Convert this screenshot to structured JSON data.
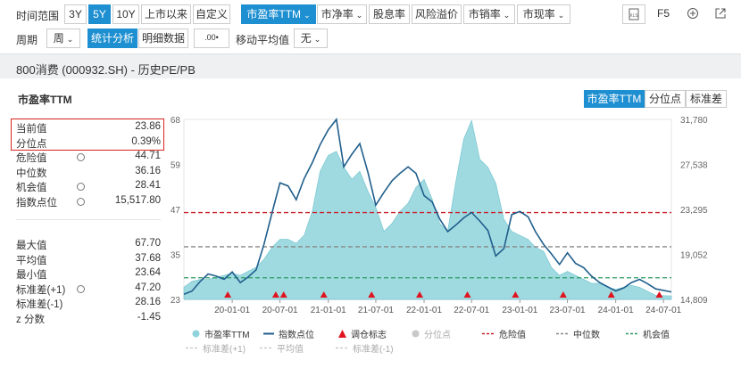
{
  "toolbar1": {
    "range_label": "时间范围",
    "range_buttons": [
      "3Y",
      "5Y",
      "10Y",
      "上市以来",
      "自定义"
    ],
    "metric_buttons": [
      "市盈率TTM",
      "市净率",
      "股息率",
      "风险溢价",
      "市销率",
      "市现率"
    ],
    "right_icons": [
      "excel-icon",
      "refresh-icon",
      "zoom-in-icon",
      "share-icon"
    ],
    "refresh_label": "F5"
  },
  "toolbar2": {
    "period_label": "周期",
    "period_value": "周",
    "analysis_tabs": [
      "统计分析",
      "明细数据"
    ],
    "decimal_icon_text": ".00",
    "moving_avg_label": "移动平均值",
    "moving_avg_value": "无"
  },
  "header": {
    "title": "800消费 (000932.SH) - 历史PE/PB"
  },
  "chart_title": "市盈率TTM",
  "view_tabs": [
    "市盈率TTM",
    "分位点",
    "标准差"
  ],
  "stats": [
    {
      "k": "当前值",
      "v": "23.86",
      "icon": false
    },
    {
      "k": "分位点",
      "v": "0.39%",
      "icon": false
    },
    {
      "k": "危险值",
      "v": "44.71",
      "icon": true
    },
    {
      "k": "中位数",
      "v": "36.16",
      "icon": false
    },
    {
      "k": "机会值",
      "v": "28.41",
      "icon": true
    },
    {
      "k": "指数点位",
      "v": "15,517.80",
      "icon": true
    }
  ],
  "stats2": [
    {
      "k": "最大值",
      "v": "67.70",
      "icon": false
    },
    {
      "k": "平均值",
      "v": "37.68",
      "icon": false
    },
    {
      "k": "最小值",
      "v": "23.64",
      "icon": false
    },
    {
      "k": "标准差(+1)",
      "v": "47.20",
      "icon": true
    },
    {
      "k": "标准差(-1)",
      "v": "28.16",
      "icon": false
    },
    {
      "k": "z 分数",
      "v": "-1.45",
      "icon": false
    }
  ],
  "legend": [
    {
      "label": "市盈率TTM",
      "active": true
    },
    {
      "label": "指数点位",
      "active": true
    },
    {
      "label": "调仓标志",
      "active": true
    },
    {
      "label": "分位点",
      "active": false
    },
    {
      "label": "危险值",
      "active": true
    },
    {
      "label": "中位数",
      "active": true
    },
    {
      "label": "机会值",
      "active": true
    },
    {
      "label": "标准差(+1)",
      "active": false
    },
    {
      "label": "平均值",
      "active": false
    },
    {
      "label": "标准差(-1)",
      "active": false
    }
  ],
  "colors": {
    "accent": "#1e8fd1",
    "pe_area": "#8fd3dc",
    "index_line": "#1f5e8c",
    "danger": "#c8232c",
    "median": "#888888",
    "opportunity": "#2a9b5f",
    "marker": "#e0141e"
  },
  "chart_data": {
    "type": "area",
    "title": "市盈率TTM",
    "y_left_ticks": [
      "68",
      "59",
      "47",
      "35",
      "23"
    ],
    "y_left_range": [
      23,
      68
    ],
    "y_right_ticks": [
      "31,780",
      "27,538",
      "23,295",
      "19,052",
      "14,809"
    ],
    "y_right_range": [
      14809,
      31780
    ],
    "x_ticks": [
      "20-01-01",
      "20-07-01",
      "21-01-01",
      "21-07-01",
      "22-01-01",
      "22-07-01",
      "23-01-01",
      "23-07-01",
      "24-01-01",
      "24-07-01"
    ],
    "x_range": [
      "2019-07-01",
      "2024-07-31"
    ],
    "reference_lines": {
      "danger": 44.71,
      "median": 36.16,
      "opportunity": 28.41
    },
    "pe_series": [
      [
        "2019-07-01",
        26
      ],
      [
        "2019-08-01",
        27.5
      ],
      [
        "2019-09-01",
        28
      ],
      [
        "2019-10-01",
        28
      ],
      [
        "2019-11-01",
        28.5
      ],
      [
        "2019-12-01",
        29
      ],
      [
        "2020-01-01",
        29.5
      ],
      [
        "2020-02-01",
        29
      ],
      [
        "2020-03-01",
        30
      ],
      [
        "2020-04-01",
        31
      ],
      [
        "2020-05-01",
        33
      ],
      [
        "2020-06-01",
        36
      ],
      [
        "2020-07-01",
        38
      ],
      [
        "2020-08-01",
        38
      ],
      [
        "2020-09-01",
        37
      ],
      [
        "2020-10-01",
        39
      ],
      [
        "2020-11-01",
        45
      ],
      [
        "2020-12-01",
        55
      ],
      [
        "2021-01-01",
        59
      ],
      [
        "2021-02-01",
        60
      ],
      [
        "2021-03-01",
        56
      ],
      [
        "2021-04-01",
        53
      ],
      [
        "2021-05-01",
        55
      ],
      [
        "2021-06-01",
        50
      ],
      [
        "2021-07-01",
        46
      ],
      [
        "2021-08-01",
        40
      ],
      [
        "2021-09-01",
        42
      ],
      [
        "2021-10-01",
        45
      ],
      [
        "2021-11-01",
        47
      ],
      [
        "2021-12-01",
        51
      ],
      [
        "2022-01-01",
        53
      ],
      [
        "2022-02-01",
        48
      ],
      [
        "2022-03-01",
        42
      ],
      [
        "2022-04-01",
        40
      ],
      [
        "2022-05-01",
        52
      ],
      [
        "2022-06-01",
        63
      ],
      [
        "2022-07-01",
        67.7
      ],
      [
        "2022-08-01",
        58
      ],
      [
        "2022-09-01",
        56
      ],
      [
        "2022-10-01",
        52
      ],
      [
        "2022-11-01",
        43
      ],
      [
        "2022-12-01",
        40
      ],
      [
        "2023-01-01",
        39
      ],
      [
        "2023-02-01",
        38
      ],
      [
        "2023-03-01",
        36
      ],
      [
        "2023-04-01",
        35
      ],
      [
        "2023-05-01",
        31
      ],
      [
        "2023-06-01",
        29
      ],
      [
        "2023-07-01",
        30
      ],
      [
        "2023-08-01",
        29
      ],
      [
        "2023-09-01",
        28
      ],
      [
        "2023-10-01",
        27
      ],
      [
        "2023-11-01",
        27
      ],
      [
        "2023-12-01",
        26
      ],
      [
        "2024-01-01",
        25.5
      ],
      [
        "2024-02-01",
        26
      ],
      [
        "2024-03-01",
        26.5
      ],
      [
        "2024-04-01",
        26
      ],
      [
        "2024-05-01",
        25
      ],
      [
        "2024-06-01",
        24
      ],
      [
        "2024-07-31",
        23.86
      ]
    ],
    "index_series": [
      [
        "2019-07-01",
        15300
      ],
      [
        "2019-08-01",
        15600
      ],
      [
        "2019-09-01",
        16500
      ],
      [
        "2019-10-01",
        17200
      ],
      [
        "2019-11-01",
        17000
      ],
      [
        "2019-12-01",
        16700
      ],
      [
        "2020-01-01",
        17400
      ],
      [
        "2020-02-01",
        16400
      ],
      [
        "2020-03-01",
        16900
      ],
      [
        "2020-04-01",
        17600
      ],
      [
        "2020-05-01",
        20000
      ],
      [
        "2020-06-01",
        23000
      ],
      [
        "2020-07-01",
        25800
      ],
      [
        "2020-08-01",
        25500
      ],
      [
        "2020-09-01",
        24200
      ],
      [
        "2020-10-01",
        26200
      ],
      [
        "2020-11-01",
        27700
      ],
      [
        "2020-12-01",
        29400
      ],
      [
        "2021-01-01",
        30800
      ],
      [
        "2021-02-01",
        31780
      ],
      [
        "2021-03-01",
        27300
      ],
      [
        "2021-04-01",
        28500
      ],
      [
        "2021-05-01",
        29500
      ],
      [
        "2021-06-01",
        26800
      ],
      [
        "2021-07-01",
        23700
      ],
      [
        "2021-08-01",
        24900
      ],
      [
        "2021-09-01",
        26000
      ],
      [
        "2021-10-01",
        26700
      ],
      [
        "2021-11-01",
        27300
      ],
      [
        "2021-12-01",
        26700
      ],
      [
        "2022-01-01",
        24600
      ],
      [
        "2022-02-01",
        24000
      ],
      [
        "2022-03-01",
        22400
      ],
      [
        "2022-04-01",
        21200
      ],
      [
        "2022-05-01",
        21800
      ],
      [
        "2022-06-01",
        22500
      ],
      [
        "2022-07-01",
        23000
      ],
      [
        "2022-08-01",
        22200
      ],
      [
        "2022-09-01",
        21300
      ],
      [
        "2022-10-01",
        18900
      ],
      [
        "2022-11-01",
        19600
      ],
      [
        "2022-12-01",
        22800
      ],
      [
        "2023-01-01",
        23100
      ],
      [
        "2023-02-01",
        22600
      ],
      [
        "2023-03-01",
        21200
      ],
      [
        "2023-04-01",
        20000
      ],
      [
        "2023-05-01",
        19100
      ],
      [
        "2023-06-01",
        18100
      ],
      [
        "2023-07-01",
        19200
      ],
      [
        "2023-08-01",
        18200
      ],
      [
        "2023-09-01",
        17800
      ],
      [
        "2023-10-01",
        17000
      ],
      [
        "2023-11-01",
        16400
      ],
      [
        "2023-12-01",
        16000
      ],
      [
        "2024-01-01",
        15600
      ],
      [
        "2024-02-01",
        15900
      ],
      [
        "2024-03-01",
        16400
      ],
      [
        "2024-04-01",
        16700
      ],
      [
        "2024-05-01",
        16300
      ],
      [
        "2024-06-01",
        15800
      ],
      [
        "2024-07-31",
        15517.8
      ]
    ],
    "rebalance_markers": [
      "2019-12-15",
      "2020-06-15",
      "2020-07-15",
      "2020-12-15",
      "2021-06-15",
      "2021-12-15",
      "2022-06-15",
      "2022-12-15",
      "2023-06-15",
      "2023-12-15",
      "2024-06-15"
    ]
  }
}
